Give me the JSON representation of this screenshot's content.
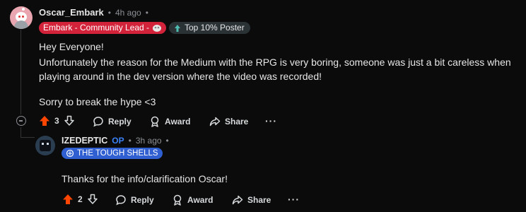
{
  "comment": {
    "username": "Oscar_Embark",
    "time": "4h ago",
    "flair": "Embark - Community Lead -",
    "badge": "Top 10% Poster",
    "body": [
      "Hey Everyone!",
      "Unfortunately the reason for the Medium with the RPG is very boring, someone was just a bit careless when",
      "playing around in the dev version where the video was recorded!",
      "Sorry to break the hype <3"
    ],
    "votes": "3",
    "actions": {
      "reply": "Reply",
      "award": "Award",
      "share": "Share"
    },
    "colors": {
      "upvote": "#ff4500",
      "flair": "#d3233b"
    }
  },
  "reply": {
    "username": "IZEDEPTIC",
    "op_tag": "OP",
    "time": "3h ago",
    "flair": "THE TOUGH SHELLS",
    "body": "Thanks for the info/clarification Oscar!",
    "votes": "2",
    "actions": {
      "reply": "Reply",
      "award": "Award",
      "share": "Share"
    },
    "colors": {
      "flair": "#2f5fd0"
    }
  },
  "separator": "•"
}
